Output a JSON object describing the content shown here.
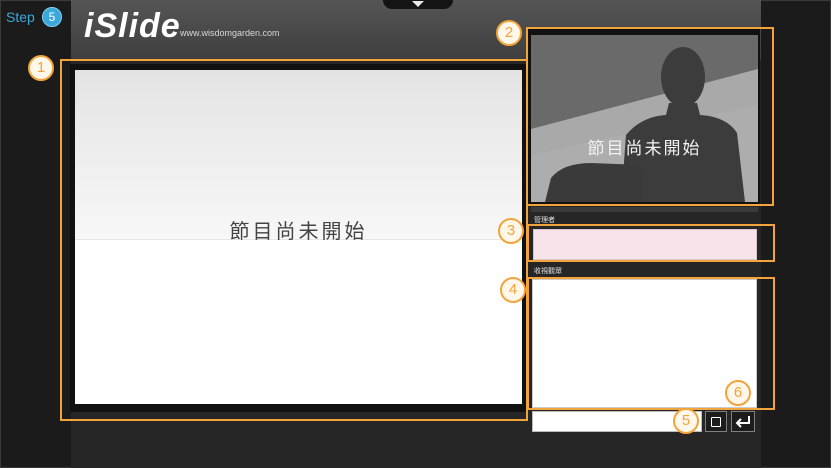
{
  "tutorial": {
    "step_label": "Step",
    "step_number": "5",
    "callouts": [
      "1",
      "2",
      "3",
      "4",
      "5",
      "6"
    ],
    "highlight_color": "#f2a33a"
  },
  "header": {
    "logo_text": "iSlide",
    "logo_url": "www.wisdomgarden.com",
    "collapse_icon": "chevron-down-icon"
  },
  "slide": {
    "status_text": "節目尚未開始"
  },
  "video": {
    "status_text": "節目尚未開始"
  },
  "admin": {
    "label": "管理者",
    "value": ""
  },
  "chat": {
    "label": "收視觀眾",
    "input_value": "",
    "window_icon": "window-icon",
    "enter_icon": "enter-icon"
  }
}
